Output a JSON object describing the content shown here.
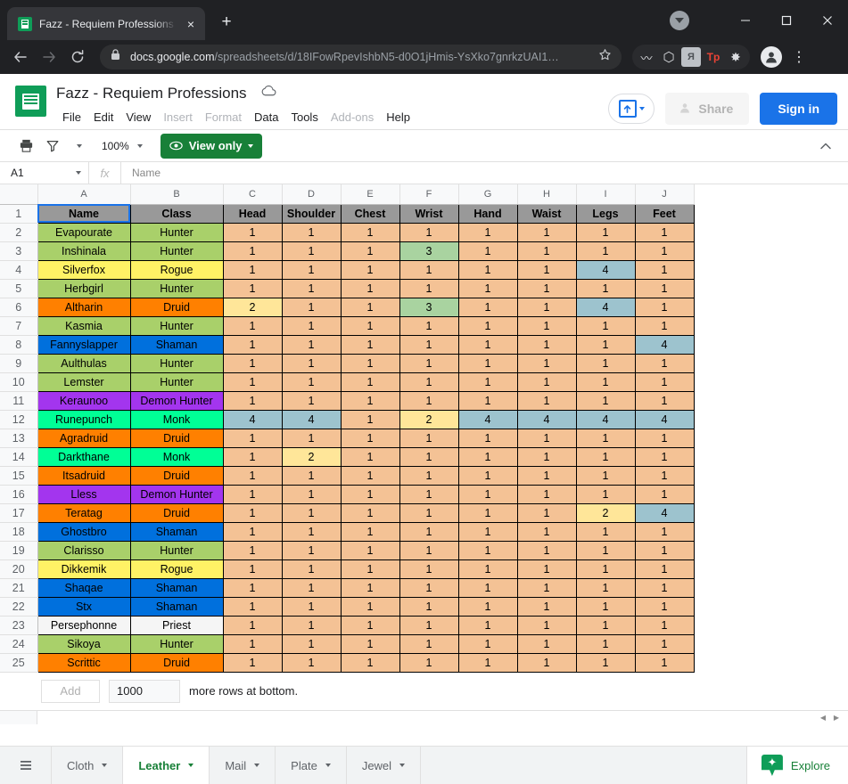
{
  "browser": {
    "tab": {
      "title": "Fazz - Requiem Professions - Goo",
      "favicon": "sheets-favicon",
      "close": "×"
    },
    "newtab_label": "+",
    "window_controls": {
      "minimize": "minimize-icon",
      "maximize": "maximize-icon",
      "close": "close-icon"
    },
    "nav": {
      "back": "←",
      "forward": "→",
      "reload": "⟳"
    },
    "omnibox": {
      "lock": "lock-icon",
      "domain": "docs.google.com",
      "path": "/spreadsheets/d/18IFowRpevIshbN5-d0O1jHmis-YsXko7gnrkzUAI1…",
      "star": "☆"
    },
    "extensions": [
      {
        "name": "wavy-extension-icon",
        "glyph": "〰",
        "color": "#e8eaed",
        "bg": "transparent"
      },
      {
        "name": "cube-extension-icon",
        "glyph": "⬡",
        "color": "#dadce0",
        "bg": "transparent"
      },
      {
        "name": "script-extension-icon",
        "glyph": "R",
        "color": "#5f6368",
        "bg": "#bdc1c6"
      },
      {
        "name": "tp-extension-icon",
        "glyph": "Tp",
        "color": "#ea4335",
        "bg": "transparent"
      },
      {
        "name": "puzzle-extensions-icon",
        "glyph": "❖",
        "color": "#dadce0",
        "bg": "transparent"
      }
    ],
    "profile": "avatar-icon",
    "menu": "⋮"
  },
  "docs": {
    "logo": "sheets-logo",
    "title": "Fazz - Requiem Professions",
    "cloud_status": "cloud-icon",
    "menus": [
      {
        "label": "File",
        "dim": false
      },
      {
        "label": "Edit",
        "dim": false
      },
      {
        "label": "View",
        "dim": false
      },
      {
        "label": "Insert",
        "dim": true
      },
      {
        "label": "Format",
        "dim": true
      },
      {
        "label": "Data",
        "dim": false
      },
      {
        "label": "Tools",
        "dim": false
      },
      {
        "label": "Add-ons",
        "dim": true
      },
      {
        "label": "Help",
        "dim": false
      }
    ],
    "upload_button": "upload-icon",
    "share_label": "Share",
    "signin_label": "Sign in"
  },
  "toolbar": {
    "print": "print-icon",
    "filter": "filter-icon",
    "zoom_level": "100%",
    "view_only_label": "View only",
    "collapse": "chevron-up-icon"
  },
  "formulabar": {
    "cell_ref": "A1",
    "fx": "fx",
    "value": "Name"
  },
  "grid": {
    "column_letters": [
      "A",
      "B",
      "C",
      "D",
      "E",
      "F",
      "G",
      "H",
      "I",
      "J"
    ],
    "headers": [
      "Name",
      "Class",
      "Head",
      "Shoulder",
      "Chest",
      "Wrist",
      "Hand",
      "Waist",
      "Legs",
      "Feet"
    ],
    "selected_cell": "A1",
    "row_numbers": [
      1,
      2,
      3,
      4,
      5,
      6,
      7,
      8,
      9,
      10,
      11,
      12,
      13,
      14,
      15,
      16,
      17,
      18,
      19,
      20,
      21,
      22,
      23,
      24,
      25
    ],
    "class_colors": {
      "Hunter": "#a9d06a",
      "Rogue": "#fff265",
      "Druid": "#ff8000",
      "Shaman": "#0070dd",
      "Demon Hunter": "#a335ee",
      "Monk": "#00ff96",
      "Priest": "#f5f5f5"
    },
    "value_colors": {
      "1": "#f4c295",
      "2": "#ffe699",
      "3": "#a9d3a0",
      "4": "#9dc3ce"
    },
    "rows": [
      {
        "row": 2,
        "name": "Evapourate",
        "class": "Hunter",
        "values": [
          1,
          1,
          1,
          1,
          1,
          1,
          1,
          1
        ]
      },
      {
        "row": 3,
        "name": "Inshinala",
        "class": "Hunter",
        "values": [
          1,
          1,
          1,
          3,
          1,
          1,
          1,
          1
        ]
      },
      {
        "row": 4,
        "name": "Silverfox",
        "class": "Rogue",
        "values": [
          1,
          1,
          1,
          1,
          1,
          1,
          4,
          1
        ]
      },
      {
        "row": 5,
        "name": "Herbgirl",
        "class": "Hunter",
        "values": [
          1,
          1,
          1,
          1,
          1,
          1,
          1,
          1
        ]
      },
      {
        "row": 6,
        "name": "Altharin",
        "class": "Druid",
        "values": [
          2,
          1,
          1,
          3,
          1,
          1,
          4,
          1
        ]
      },
      {
        "row": 7,
        "name": "Kasmia",
        "class": "Hunter",
        "values": [
          1,
          1,
          1,
          1,
          1,
          1,
          1,
          1
        ]
      },
      {
        "row": 8,
        "name": "Fannyslapper",
        "class": "Shaman",
        "values": [
          1,
          1,
          1,
          1,
          1,
          1,
          1,
          4
        ]
      },
      {
        "row": 9,
        "name": "Aulthulas",
        "class": "Hunter",
        "values": [
          1,
          1,
          1,
          1,
          1,
          1,
          1,
          1
        ]
      },
      {
        "row": 10,
        "name": "Lemster",
        "class": "Hunter",
        "values": [
          1,
          1,
          1,
          1,
          1,
          1,
          1,
          1
        ]
      },
      {
        "row": 11,
        "name": "Keraunoo",
        "class": "Demon Hunter",
        "values": [
          1,
          1,
          1,
          1,
          1,
          1,
          1,
          1
        ]
      },
      {
        "row": 12,
        "name": "Runepunch",
        "class": "Monk",
        "values": [
          4,
          4,
          1,
          2,
          4,
          4,
          4,
          4
        ]
      },
      {
        "row": 13,
        "name": "Agradruid",
        "class": "Druid",
        "values": [
          1,
          1,
          1,
          1,
          1,
          1,
          1,
          1
        ]
      },
      {
        "row": 14,
        "name": "Darkthane",
        "class": "Monk",
        "values": [
          1,
          2,
          1,
          1,
          1,
          1,
          1,
          1
        ]
      },
      {
        "row": 15,
        "name": "Itsadruid",
        "class": "Druid",
        "values": [
          1,
          1,
          1,
          1,
          1,
          1,
          1,
          1
        ]
      },
      {
        "row": 16,
        "name": "Lless",
        "class": "Demon Hunter",
        "values": [
          1,
          1,
          1,
          1,
          1,
          1,
          1,
          1
        ]
      },
      {
        "row": 17,
        "name": "Teratag",
        "class": "Druid",
        "values": [
          1,
          1,
          1,
          1,
          1,
          1,
          2,
          4
        ]
      },
      {
        "row": 18,
        "name": "Ghostbro",
        "class": "Shaman",
        "values": [
          1,
          1,
          1,
          1,
          1,
          1,
          1,
          1
        ]
      },
      {
        "row": 19,
        "name": "Clarisso",
        "class": "Hunter",
        "values": [
          1,
          1,
          1,
          1,
          1,
          1,
          1,
          1
        ]
      },
      {
        "row": 20,
        "name": "Dikkemik",
        "class": "Rogue",
        "values": [
          1,
          1,
          1,
          1,
          1,
          1,
          1,
          1
        ]
      },
      {
        "row": 21,
        "name": "Shaqae",
        "class": "Shaman",
        "values": [
          1,
          1,
          1,
          1,
          1,
          1,
          1,
          1
        ]
      },
      {
        "row": 22,
        "name": "Stx",
        "class": "Shaman",
        "values": [
          1,
          1,
          1,
          1,
          1,
          1,
          1,
          1
        ]
      },
      {
        "row": 23,
        "name": "Persephonne",
        "class": "Priest",
        "values": [
          1,
          1,
          1,
          1,
          1,
          1,
          1,
          1
        ]
      },
      {
        "row": 24,
        "name": "Sikoya",
        "class": "Hunter",
        "values": [
          1,
          1,
          1,
          1,
          1,
          1,
          1,
          1
        ]
      },
      {
        "row": 25,
        "name": "Scrittic",
        "class": "Druid",
        "values": [
          1,
          1,
          1,
          1,
          1,
          1,
          1,
          1
        ]
      }
    ]
  },
  "add_rows": {
    "button_label": "Add",
    "count": "1000",
    "suffix": "more rows at bottom."
  },
  "scroll": {
    "left_arrow": "◀",
    "right_arrow": "▶"
  },
  "sheetbar": {
    "all_sheets": "hamburger-icon",
    "tabs": [
      {
        "label": "Cloth",
        "active": false
      },
      {
        "label": "Leather",
        "active": true
      },
      {
        "label": "Mail",
        "active": false
      },
      {
        "label": "Plate",
        "active": false
      },
      {
        "label": "Jewel",
        "active": false
      }
    ],
    "explore_label": "Explore",
    "explore_icon": "explore-icon"
  }
}
